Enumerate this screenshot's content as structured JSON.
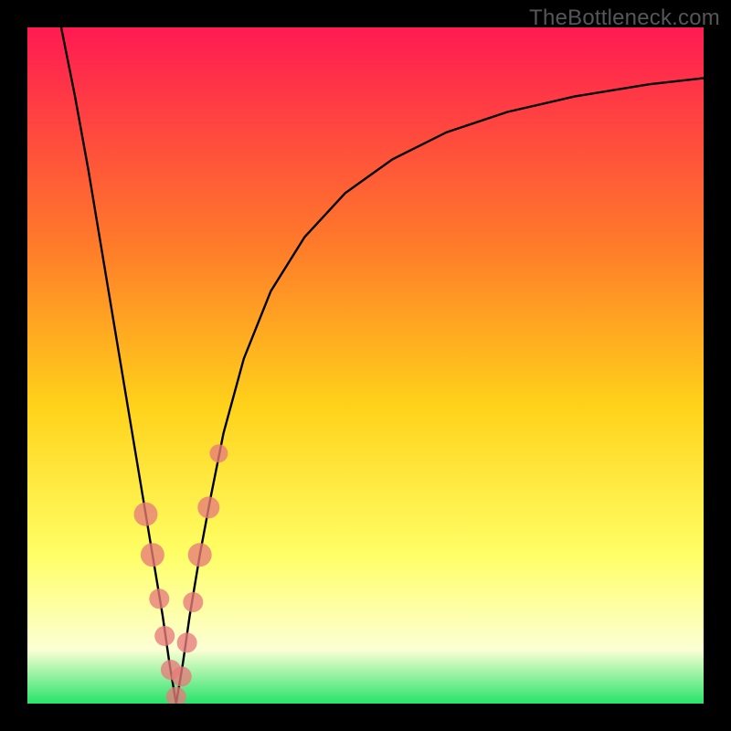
{
  "watermark": "TheBottleneck.com",
  "colors": {
    "frame": "#000000",
    "curve": "#000000",
    "marker_fill": "#e77b7b",
    "marker_stroke": "#b85a5a",
    "gradient_top": "#ff1a52",
    "gradient_mid1": "#ff7a2a",
    "gradient_mid2": "#ffd21a",
    "gradient_mid3": "#ffff66",
    "gradient_pale": "#fcffd4",
    "gradient_bottom": "#27e36b"
  },
  "chart_data": {
    "type": "line",
    "title": "",
    "xlabel": "",
    "ylabel": "",
    "xlim": [
      0,
      100
    ],
    "ylim": [
      0,
      100
    ],
    "x_min_point": 22,
    "series": [
      {
        "name": "bottleneck-curve",
        "x": [
          5,
          7,
          9,
          11,
          13,
          15,
          17,
          18.5,
          20,
          21,
          22,
          23,
          24,
          25.5,
          27,
          29,
          32,
          36,
          41,
          47,
          54,
          62,
          71,
          81,
          92,
          100
        ],
        "y": [
          100,
          90,
          79,
          67,
          55,
          43,
          31,
          22,
          13,
          6,
          0,
          6,
          13,
          22,
          30,
          40,
          51,
          61,
          69,
          75.5,
          80.5,
          84.5,
          87.5,
          89.8,
          91.6,
          92.5
        ]
      }
    ],
    "markers": {
      "name": "highlighted-points",
      "x": [
        17.5,
        18.5,
        19.5,
        20.3,
        21.2,
        22.0,
        22.8,
        23.6,
        24.5,
        25.5,
        26.8,
        28.3
      ],
      "y": [
        28.0,
        22.0,
        15.5,
        10.0,
        5.0,
        1.0,
        4.0,
        9.0,
        15.0,
        22.0,
        29.0,
        37.0
      ],
      "r": [
        13,
        13,
        11,
        11,
        11,
        11,
        11,
        11,
        11,
        13,
        12,
        10
      ]
    }
  }
}
